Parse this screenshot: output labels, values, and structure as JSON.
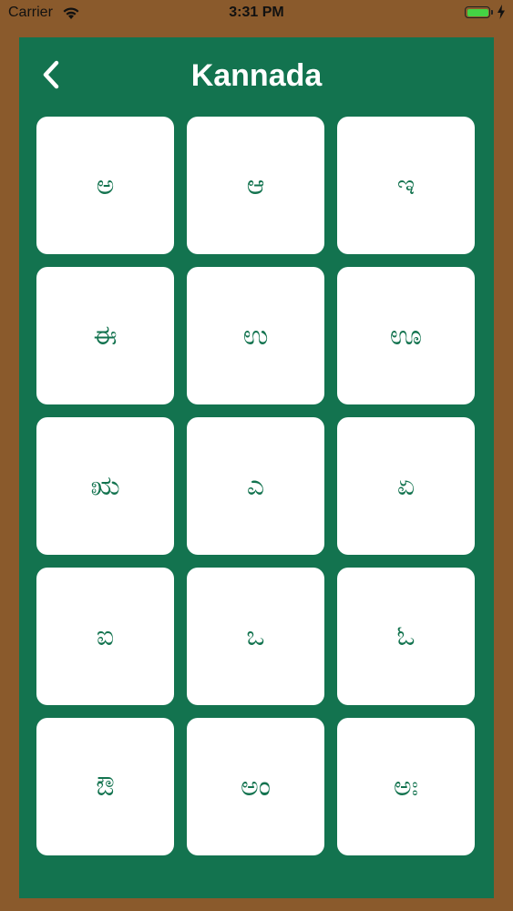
{
  "status_bar": {
    "carrier": "Carrier",
    "time": "3:31 PM",
    "battery_level": 1.0,
    "battery_color": "#44d344"
  },
  "header": {
    "title": "Kannada",
    "back_icon": "chevron-left-icon"
  },
  "colors": {
    "background": "#8a5a2c",
    "board": "#13734f",
    "tile": "#ffffff",
    "letter": "#13734f"
  },
  "letters": [
    "ಅ",
    "ಆ",
    "ಇ",
    "ಈ",
    "ಉ",
    "ಊ",
    "ಋ",
    "ಎ",
    "ಏ",
    "ಐ",
    "ಒ",
    "ಓ",
    "ಔ",
    "ಅಂ",
    "ಅಃ"
  ]
}
